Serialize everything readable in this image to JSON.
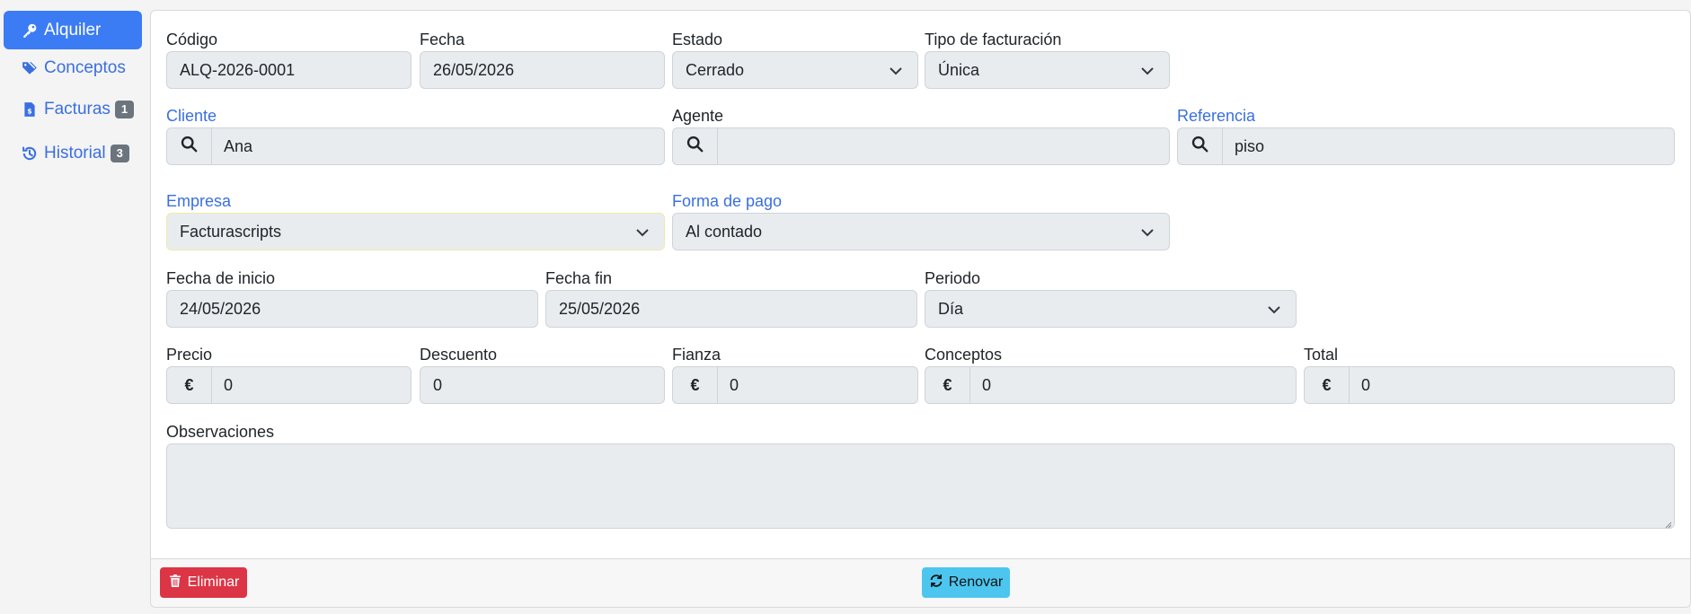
{
  "sidebar": {
    "items": [
      {
        "label": "Alquiler",
        "icon": "key-icon",
        "active": true
      },
      {
        "label": "Conceptos",
        "icon": "tags-icon"
      },
      {
        "label": "Facturas",
        "icon": "invoice-icon",
        "badge": "1"
      },
      {
        "label": "Historial",
        "icon": "history-icon",
        "badge": "3"
      }
    ]
  },
  "form": {
    "codigo": {
      "label": "Código",
      "value": "ALQ-2026-0001"
    },
    "fecha": {
      "label": "Fecha",
      "value": "26/05/2026"
    },
    "estado": {
      "label": "Estado",
      "value": "Cerrado"
    },
    "tipo_facturacion": {
      "label": "Tipo de facturación",
      "value": "Única"
    },
    "cliente": {
      "label": "Cliente",
      "value": "Ana"
    },
    "agente": {
      "label": "Agente",
      "value": ""
    },
    "referencia": {
      "label": "Referencia",
      "value": "piso"
    },
    "empresa": {
      "label": "Empresa",
      "value": "Facturascripts"
    },
    "forma_pago": {
      "label": "Forma de pago",
      "value": "Al contado"
    },
    "fecha_inicio": {
      "label": "Fecha de inicio",
      "value": "24/05/2026"
    },
    "fecha_fin": {
      "label": "Fecha fin",
      "value": "25/05/2026"
    },
    "periodo": {
      "label": "Periodo",
      "value": "Día"
    },
    "precio": {
      "label": "Precio",
      "value": "0",
      "addon": "€"
    },
    "descuento": {
      "label": "Descuento",
      "value": "0"
    },
    "fianza": {
      "label": "Fianza",
      "value": "0",
      "addon": "€"
    },
    "conceptos": {
      "label": "Conceptos",
      "value": "0",
      "addon": "€"
    },
    "total": {
      "label": "Total",
      "value": "0",
      "addon": "€"
    },
    "observaciones": {
      "label": "Observaciones",
      "value": ""
    }
  },
  "footer": {
    "delete_label": "Eliminar",
    "renew_label": "Renovar"
  },
  "colors": {
    "primary": "#3b7cf5",
    "link": "#3a6fe0",
    "danger": "#dc3545",
    "info": "#4dc6ef"
  }
}
